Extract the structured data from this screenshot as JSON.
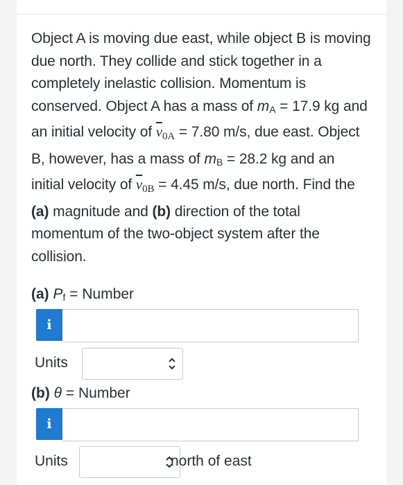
{
  "problem": {
    "s1": "Object A is moving due east, while object B is moving due north. They collide and stick together in a completely inelastic collision. Momentum is conserved. Object A has a mass of ",
    "mA_var": "m",
    "mA_sub": "A",
    "s2": " = 17.9 kg and an initial velocity of ",
    "v0A_var": "v",
    "v0A_sub": "0A",
    "s3": " = 7.80 m/s, due east. Object B, however, has a mass of ",
    "mB_var": "m",
    "mB_sub": "B",
    "s4": " = 28.2 kg and an initial velocity of ",
    "v0B_var": "v",
    "v0B_sub": "0B",
    "s5": " = 4.45 m/s, due north. Find the ",
    "a_label": "(a)",
    "s6": " magnitude and ",
    "b_label": "(b)",
    "s7": " direction of the total momentum of the two-object system after the collision."
  },
  "part_a": {
    "label": "(a)",
    "var": "P",
    "var_sub": "f",
    "eq": " = Number",
    "info_icon": "i",
    "input_value": "",
    "units_label": "Units",
    "units_value": ""
  },
  "part_b": {
    "label": "(b)",
    "var": "θ",
    "eq": " = Number",
    "info_icon": "i",
    "input_value": "",
    "units_label": "Units",
    "units_value": "",
    "after_units": "north of east"
  },
  "colors": {
    "info_button": "#1f7ad1",
    "text": "#2a2f36",
    "border": "#c9c9c9"
  }
}
